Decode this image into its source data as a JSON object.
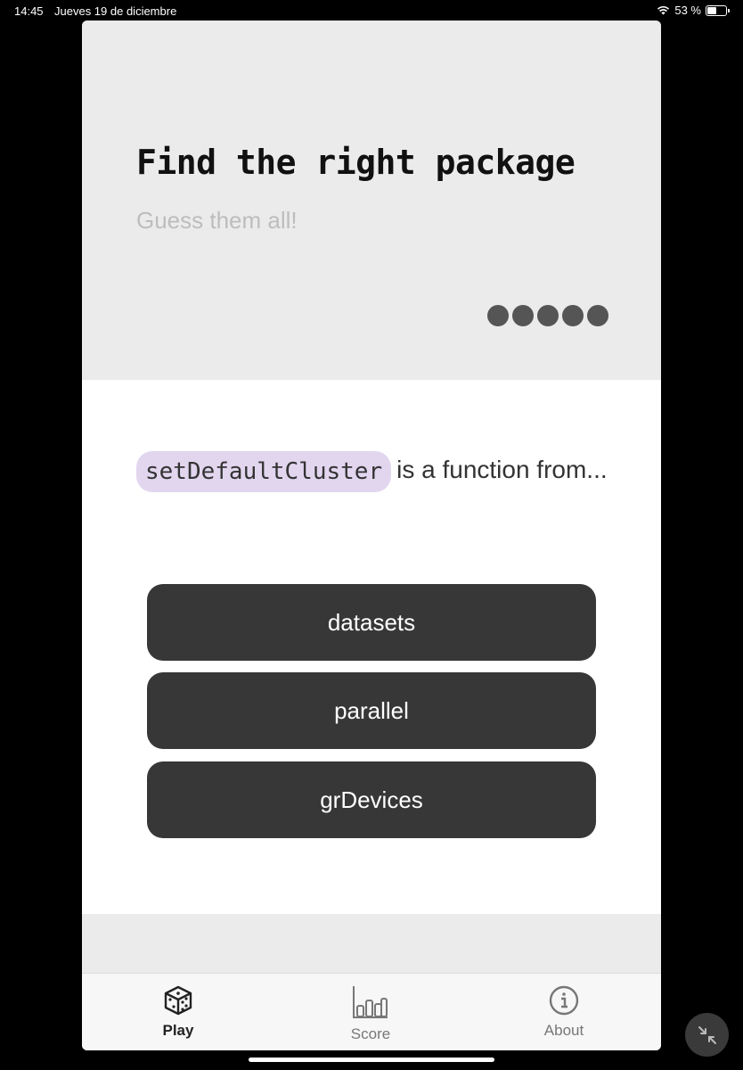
{
  "status_bar": {
    "time": "14:45",
    "date": "Jueves 19 de diciembre",
    "battery": "53 %",
    "battery_level": 0.53
  },
  "hero": {
    "title": "Find the right package",
    "subtitle": "Guess them all!",
    "progress_dots": 5
  },
  "question": {
    "function_name": "setDefaultCluster",
    "prompt": "is a function from..."
  },
  "answers": [
    "datasets",
    "parallel",
    "grDevices"
  ],
  "tabs": {
    "play": "Play",
    "score": "Score",
    "about": "About"
  },
  "colors": {
    "code_highlight": "#e2d6ef",
    "button_bg": "#373737",
    "hero_bg": "#ebebeb"
  }
}
